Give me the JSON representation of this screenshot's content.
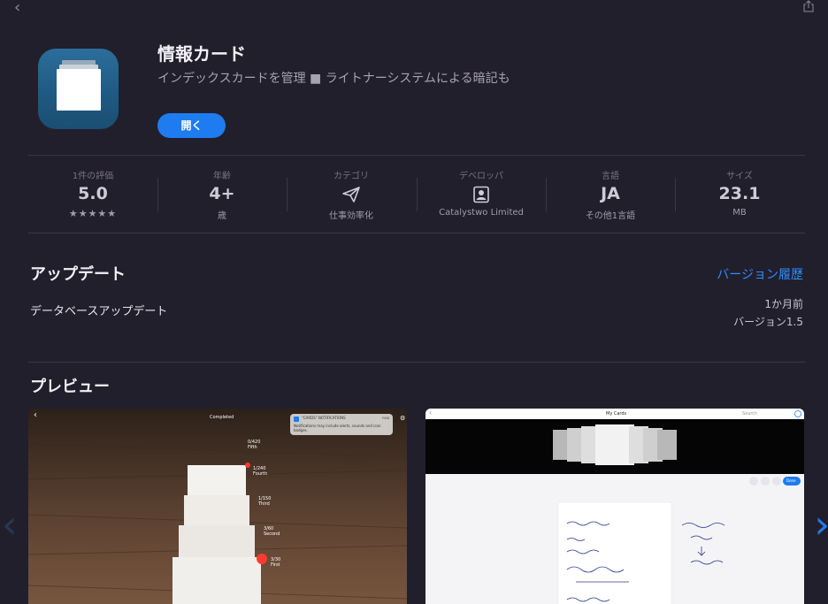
{
  "app": {
    "title": "情報カード",
    "subtitle": "インデックスカードを管理 ■ ライトナーシステムによる暗記も",
    "open_label": "開く"
  },
  "stats": [
    {
      "label": "1件の評価",
      "value": "5.0",
      "sub": "★★★★★",
      "kind": "text"
    },
    {
      "label": "年齢",
      "value": "4+",
      "sub": "歳",
      "kind": "text"
    },
    {
      "label": "カテゴリ",
      "icon": "paper-plane-icon",
      "sub": "仕事効率化",
      "kind": "icon"
    },
    {
      "label": "デベロッパ",
      "icon": "person-badge-icon",
      "sub": "Catalystwo Limited",
      "kind": "icon"
    },
    {
      "label": "言語",
      "value": "JA",
      "sub": "その他1言語",
      "kind": "text"
    },
    {
      "label": "サイズ",
      "value": "23.1",
      "sub": "MB",
      "kind": "text"
    }
  ],
  "updates": {
    "title": "アップデート",
    "version_history_link": "バージョン履歴",
    "note": "データベースアップデート",
    "date": "1か月前",
    "version": "バージョン1.5"
  },
  "preview": {
    "title": "プレビュー",
    "shot1": {
      "header": "Completed",
      "notification_title": "\"CARDS\" NOTIFICATIONS",
      "notification_time": "now",
      "notification_body": "Notifications may include alerts, sounds and icon badges.",
      "levels": [
        {
          "count": "0/420",
          "name": "Fifth"
        },
        {
          "count": "1/240",
          "name": "Fourth"
        },
        {
          "count": "1/150",
          "name": "Third"
        },
        {
          "count": "3/60",
          "name": "Second"
        },
        {
          "count": "3/30",
          "name": "First"
        }
      ]
    },
    "shot2": {
      "header": "My Cards",
      "search_placeholder": "Search",
      "done_label": "Done"
    }
  },
  "colors": {
    "background": "#221f2c",
    "accent": "#1e7cf0",
    "link": "#2f8cff"
  }
}
